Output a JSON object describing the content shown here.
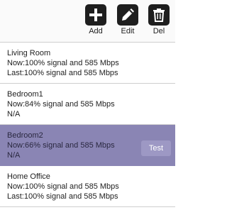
{
  "toolbar": {
    "add": {
      "label": "Add",
      "icon": "plus-icon"
    },
    "edit": {
      "label": "Edit",
      "icon": "pencil-icon"
    },
    "del": {
      "label": "Del",
      "icon": "trash-icon"
    }
  },
  "locations": [
    {
      "name": "Living Room",
      "now": "Now:100% signal and 585 Mbps",
      "last": "Last:100% signal and 585 Mbps",
      "selected": false
    },
    {
      "name": "Bedroom1",
      "now": "Now:84% signal and 585 Mbps",
      "last": "N/A",
      "selected": false
    },
    {
      "name": "Bedroom2",
      "now": "Now:66% signal and 585 Mbps",
      "last": "N/A",
      "selected": true,
      "action": "Test"
    },
    {
      "name": "Home Office",
      "now": "Now:100% signal and 585 Mbps",
      "last": "Last:100% signal and 585 Mbps",
      "selected": false
    }
  ],
  "colors": {
    "selected_row": "#8a85b4",
    "test_button": "#9d98c4",
    "icon_bg": "#1e1e1e"
  }
}
